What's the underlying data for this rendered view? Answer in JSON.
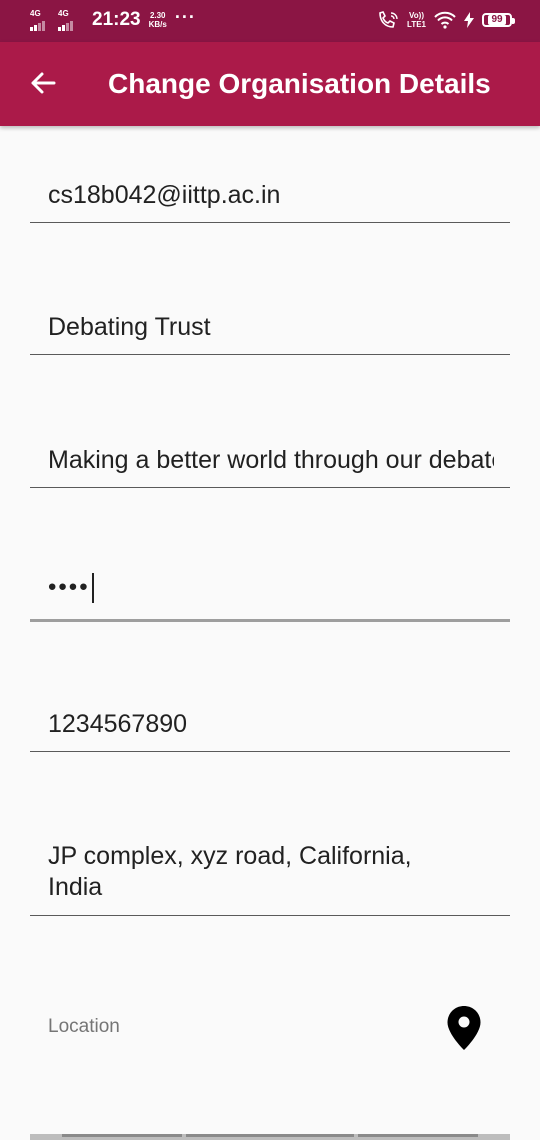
{
  "status_bar": {
    "sim1": "4G",
    "sim2": "4G",
    "time": "21:23",
    "speed_value": "2.30",
    "speed_unit": "KB/s",
    "more": "···",
    "volte_top": "Vo))",
    "volte_bottom": "LTE1",
    "battery": "99"
  },
  "app_bar": {
    "title": "Change Organisation Details"
  },
  "form": {
    "email": "cs18b042@iittp.ac.in",
    "organisation_name": "Debating Trust",
    "description": "Making a better world through our debates",
    "password": "••••",
    "phone": "1234567890",
    "address": "JP complex,  xyz road,  California, India",
    "location_label": "Location"
  },
  "colors": {
    "status_bar": "#8b1544",
    "app_bar": "#ab1a49",
    "background": "#fafafa"
  }
}
